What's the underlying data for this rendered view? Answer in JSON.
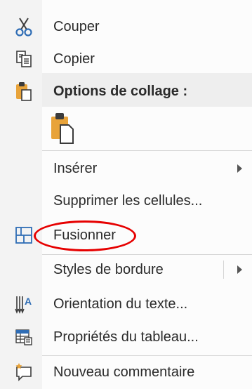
{
  "menu": {
    "items": [
      {
        "label": "Couper",
        "icon": "scissors-icon"
      },
      {
        "label": "Copier",
        "icon": "copy-icon"
      },
      {
        "label": "Options de collage :",
        "icon": "paste-icon"
      },
      {
        "label": "Insérer",
        "submenu": true
      },
      {
        "label": "Supprimer les cellules..."
      },
      {
        "label": "Fusionner",
        "icon": "merge-cells-icon"
      },
      {
        "label": "Styles de bordure",
        "submenu": true
      },
      {
        "label": "Orientation du texte...",
        "icon": "text-direction-icon"
      },
      {
        "label": "Propriétés du tableau...",
        "icon": "table-properties-icon"
      },
      {
        "label": "Nouveau commentaire",
        "icon": "new-comment-icon"
      }
    ],
    "paste_option_icon": "paste-keep-source-icon"
  },
  "colors": {
    "annotation": "#e60000",
    "icon_blue": "#2f6db5",
    "icon_dark": "#3b3b3b",
    "paste_orange": "#e8a33a"
  }
}
